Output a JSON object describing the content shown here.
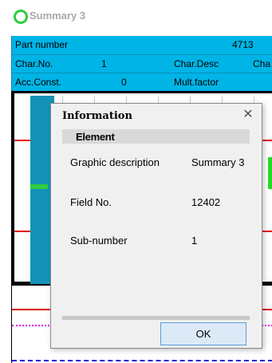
{
  "window": {
    "title": "Summary 3",
    "status_color": "#2ecc40"
  },
  "header": {
    "part_number_label": "Part number",
    "part_number_value": "4713",
    "char_no_label": "Char.No.",
    "char_no_value": "1",
    "char_desc_label": "Char.Desc",
    "char_desc_value": "Cha",
    "acc_const_label": "Acc.Const.",
    "acc_const_value": "0",
    "mult_factor_label": "Mult.factor",
    "background_color": "#00b4e6"
  },
  "dialog": {
    "title": "Information",
    "close_icon": "close-icon",
    "section": "Element",
    "fields": [
      {
        "label": "Graphic description",
        "value": "Summary 3"
      },
      {
        "label": "Field No.",
        "value": "12402"
      },
      {
        "label": "Sub-number",
        "value": "1"
      }
    ],
    "ok_label": "OK"
  }
}
